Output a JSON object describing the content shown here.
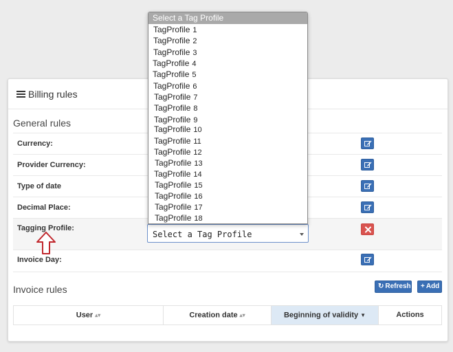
{
  "panel": {
    "title": "Billing rules"
  },
  "general_rules": {
    "title": "General rules",
    "rows": [
      {
        "label": "Currency:",
        "action": "edit"
      },
      {
        "label": "Provider Currency:",
        "action": "edit"
      },
      {
        "label": "Type of date",
        "action": "edit"
      },
      {
        "label": "Decimal Place:",
        "action": "edit"
      },
      {
        "label": "Tagging Profile:",
        "action": "delete"
      },
      {
        "label": "Invoice Day:",
        "action": "edit"
      }
    ]
  },
  "tag_profile_select": {
    "selected": "Select a Tag Profile",
    "options": [
      {
        "name": "TagProfile",
        "num": "1"
      },
      {
        "name": "TagProfile",
        "num": "2"
      },
      {
        "name": "TagProfile",
        "num": "3"
      },
      {
        "name": "TagProfile",
        "num": "4"
      },
      {
        "name": "TagProfile",
        "num": "5"
      },
      {
        "name": "TagProfile",
        "num": "6"
      },
      {
        "name": "TagProfile",
        "num": "7"
      },
      {
        "name": "TagProfile",
        "num": "8"
      },
      {
        "name": "TagProfile",
        "num": "9"
      },
      {
        "name": "TagProfile",
        "num": "10"
      },
      {
        "name": "TagProfile",
        "num": "11"
      },
      {
        "name": "TagProfile",
        "num": "12"
      },
      {
        "name": "TagProfile",
        "num": "13"
      },
      {
        "name": "TagProfile",
        "num": "14"
      },
      {
        "name": "TagProfile",
        "num": "15"
      },
      {
        "name": "TagProfile",
        "num": "16"
      },
      {
        "name": "TagProfile",
        "num": "17"
      },
      {
        "name": "TagProfile",
        "num": "18"
      }
    ]
  },
  "invoice_rules": {
    "title": "Invoice rules",
    "refresh_label": "Refresh",
    "add_label": "Add",
    "columns": [
      {
        "label": "User",
        "sort": "both"
      },
      {
        "label": "Creation date",
        "sort": "both"
      },
      {
        "label": "Beginning of validity",
        "sort": "desc"
      },
      {
        "label": "Actions",
        "sort": "none"
      }
    ]
  },
  "colors": {
    "primary": "#3a6fb5",
    "danger": "#d9534f",
    "annotation": "#c0262c"
  }
}
